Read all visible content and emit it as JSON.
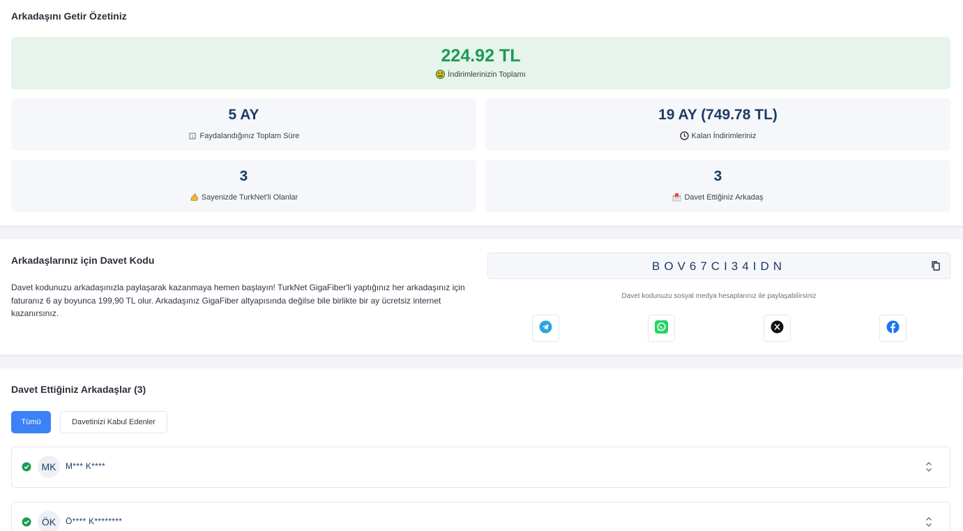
{
  "summary": {
    "title": "Arkadaşını Getir Özetiniz",
    "total": {
      "value": "224.92 TL",
      "label": "İndirimlerinizin Toplamı",
      "icon": "money-face-icon"
    },
    "stats": [
      {
        "value": "5 AY",
        "label": "Faydalandığınız Toplam Süre",
        "icon": "calendar-icon"
      },
      {
        "value": "19 AY (749.78 TL)",
        "label": "Kalan İndirimleriniz",
        "icon": "clock-icon"
      },
      {
        "value": "3",
        "label": "Sayenizde TurkNet'li Olanlar",
        "icon": "flexed-arm-icon"
      },
      {
        "value": "3",
        "label": "Davet Ettiğiniz Arkadaş",
        "icon": "envelope-icon"
      }
    ]
  },
  "invite": {
    "title": "Arkadaşlarınız için Davet Kodu",
    "description": "Davet kodunuzu arkadaşınızla paylaşarak kazanmaya hemen başlayın! TurkNet GigaFiber'li yaptığınız her arkadaşınız için faturanız 6 ay boyunca 199,90 TL olur. Arkadaşınız GigaFiber altyapısında değilse bile birlikte bir ay ücretsiz internet kazanırsınız.",
    "code": "BOV67CI34IDN",
    "share_hint": "Davet kodunuzu sosyal medya hesaplarınız ile paylaşabilirsiniz",
    "share": [
      "telegram-icon",
      "whatsapp-icon",
      "x-icon",
      "facebook-icon"
    ]
  },
  "friends": {
    "title": "Davet Ettiğiniz Arkadaşlar (3)",
    "tabs": {
      "all": "Tümü",
      "accepted": "Davetinizi Kabul Edenler"
    },
    "rows": [
      {
        "initials": "MK",
        "name": "M*** K****"
      },
      {
        "initials": "ÖK",
        "name": "Ö**** K********"
      }
    ]
  },
  "colors": {
    "accent": "#3b82f6",
    "success": "#1e9a52",
    "heading": "#1d3b66"
  }
}
